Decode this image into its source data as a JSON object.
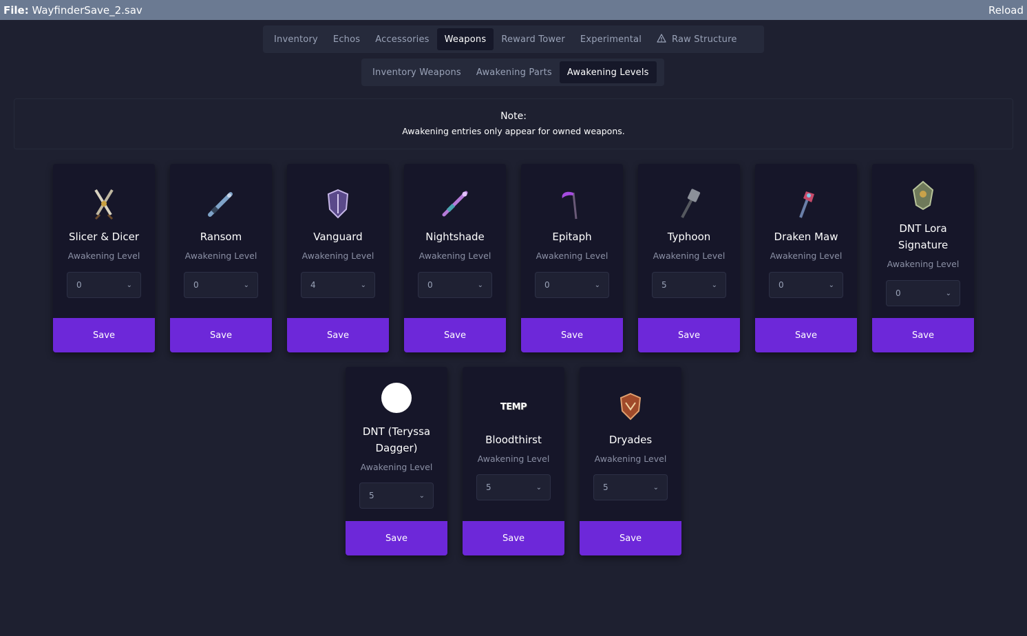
{
  "titlebar": {
    "file_label": "File:",
    "file_name": "WayfinderSave_2.sav",
    "reload_label": "Reload"
  },
  "main_tabs": [
    {
      "label": "Inventory",
      "active": false
    },
    {
      "label": "Echos",
      "active": false
    },
    {
      "label": "Accessories",
      "active": false
    },
    {
      "label": "Weapons",
      "active": true
    },
    {
      "label": "Reward Tower",
      "active": false
    },
    {
      "label": "Experimental",
      "active": false
    },
    {
      "label": "Raw Structure",
      "active": false,
      "icon": "warning-icon"
    }
  ],
  "sub_tabs": [
    {
      "label": "Inventory Weapons",
      "active": false
    },
    {
      "label": "Awakening Parts",
      "active": false
    },
    {
      "label": "Awakening Levels",
      "active": true
    }
  ],
  "note": {
    "title": "Note:",
    "text": "Awakening entries only appear for owned weapons."
  },
  "cards": [
    {
      "name": "Slicer & Dicer",
      "sublabel": "Awakening Level",
      "level": "0",
      "save_label": "Save",
      "icon": "crossed-blades-icon"
    },
    {
      "name": "Ransom",
      "sublabel": "Awakening Level",
      "level": "0",
      "save_label": "Save",
      "icon": "rifle-icon"
    },
    {
      "name": "Vanguard",
      "sublabel": "Awakening Level",
      "level": "4",
      "save_label": "Save",
      "icon": "shield-icon"
    },
    {
      "name": "Nightshade",
      "sublabel": "Awakening Level",
      "level": "0",
      "save_label": "Save",
      "icon": "staff-icon"
    },
    {
      "name": "Epitaph",
      "sublabel": "Awakening Level",
      "level": "0",
      "save_label": "Save",
      "icon": "scythe-icon"
    },
    {
      "name": "Typhoon",
      "sublabel": "Awakening Level",
      "level": "5",
      "save_label": "Save",
      "icon": "hammer-icon"
    },
    {
      "name": "Draken Maw",
      "sublabel": "Awakening Level",
      "level": "0",
      "save_label": "Save",
      "icon": "axe-icon"
    },
    {
      "name": "DNT Lora Signature",
      "sublabel": "Awakening Level",
      "level": "0",
      "save_label": "Save",
      "icon": "gauntlet-icon"
    },
    {
      "name": "DNT (Teryssa Dagger)",
      "sublabel": "Awakening Level",
      "level": "5",
      "save_label": "Save",
      "icon": "placeholder-circle-icon"
    },
    {
      "name": "Bloodthirst",
      "sublabel": "Awakening Level",
      "level": "5",
      "save_label": "Save",
      "icon": "temp-icon",
      "icon_text": "TEMP"
    },
    {
      "name": "Dryades",
      "sublabel": "Awakening Level",
      "level": "5",
      "save_label": "Save",
      "icon": "shield-crest-icon"
    }
  ],
  "colors": {
    "background": "#1e2030",
    "titlebar": "#6b7a92",
    "card": "#161629",
    "accent": "#6d28d9"
  }
}
